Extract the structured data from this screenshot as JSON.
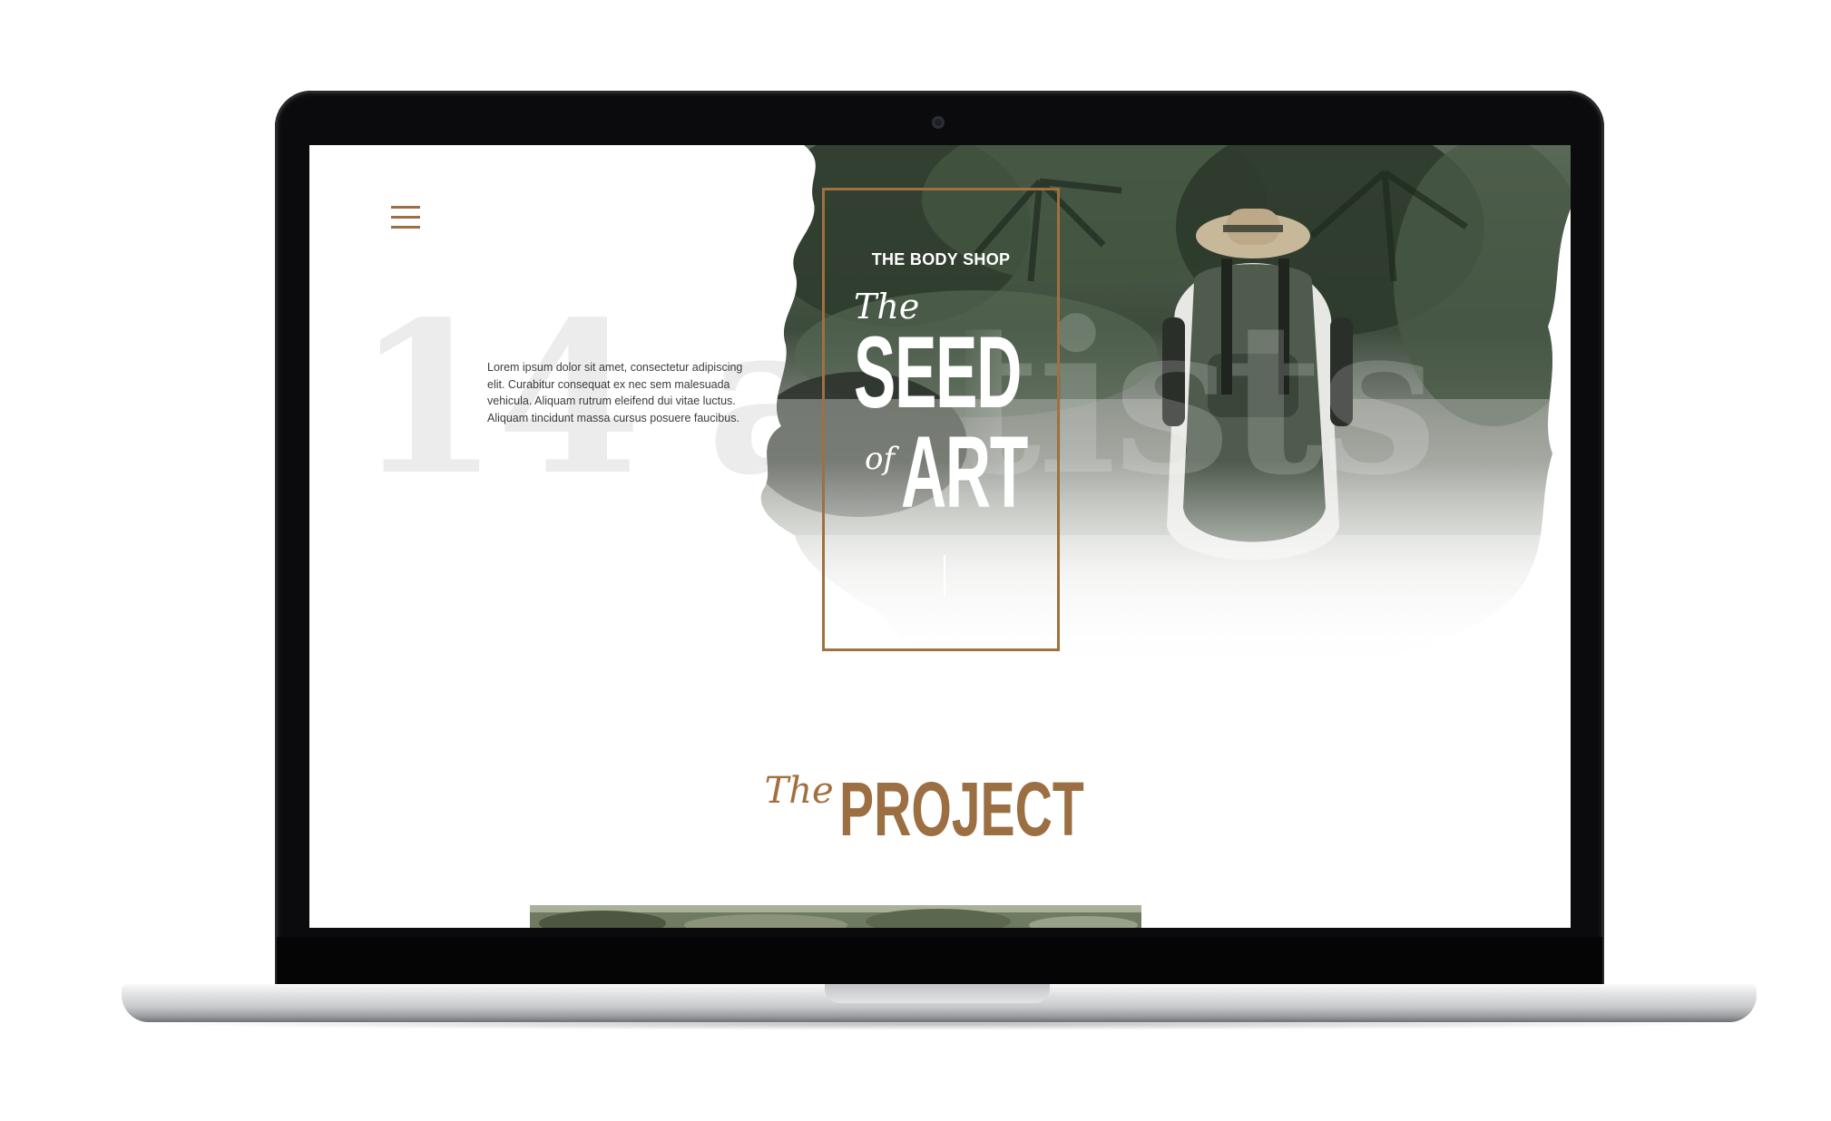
{
  "menu": {
    "icon": "hamburger-menu-icon"
  },
  "hero": {
    "background_text": "14 artists",
    "intro": "Lorem ipsum dolor sit amet, consectetur adipiscing elit. Curabitur consequat ex nec sem malesuada vehicula. Aliquam rutrum eleifend dui vitae luctus. Aliquam tincidunt massa cursus posuere faucibus.",
    "brand": "THE BODY SHOP",
    "title_the": "The",
    "title_seed": "SEED",
    "title_of": "of",
    "title_art": "ART"
  },
  "project": {
    "the": "The",
    "title": "PROJECT"
  },
  "colors": {
    "accent": "#a0703f",
    "frame": "#0b0b0d",
    "screen_bg": "#ffffff"
  }
}
